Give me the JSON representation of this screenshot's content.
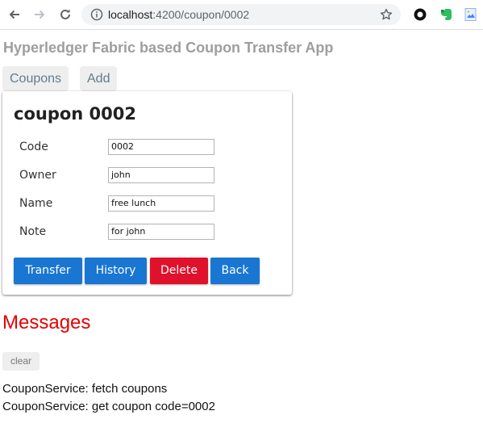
{
  "browser": {
    "url_host": "localhost",
    "url_path": ":4200/coupon/0002"
  },
  "app": {
    "title": "Hyperledger Fabric based Coupon Transfer App",
    "nav": [
      "Coupons",
      "Add"
    ]
  },
  "coupon": {
    "heading": "coupon 0002",
    "fields": [
      {
        "label": "Code",
        "value": "0002"
      },
      {
        "label": "Owner",
        "value": "john"
      },
      {
        "label": "Name",
        "value": "free lunch"
      },
      {
        "label": "Note",
        "value": "for john"
      }
    ],
    "buttons": {
      "transfer": "Transfer",
      "history": "History",
      "delete": "Delete",
      "back": "Back"
    }
  },
  "messages": {
    "title": "Messages",
    "clear_label": "clear",
    "items": [
      "CouponService: fetch coupons",
      "CouponService: get coupon code=0002"
    ]
  },
  "colors": {
    "primary": "#1976d2",
    "danger": "#e0112b",
    "messages_title": "#e60000"
  }
}
